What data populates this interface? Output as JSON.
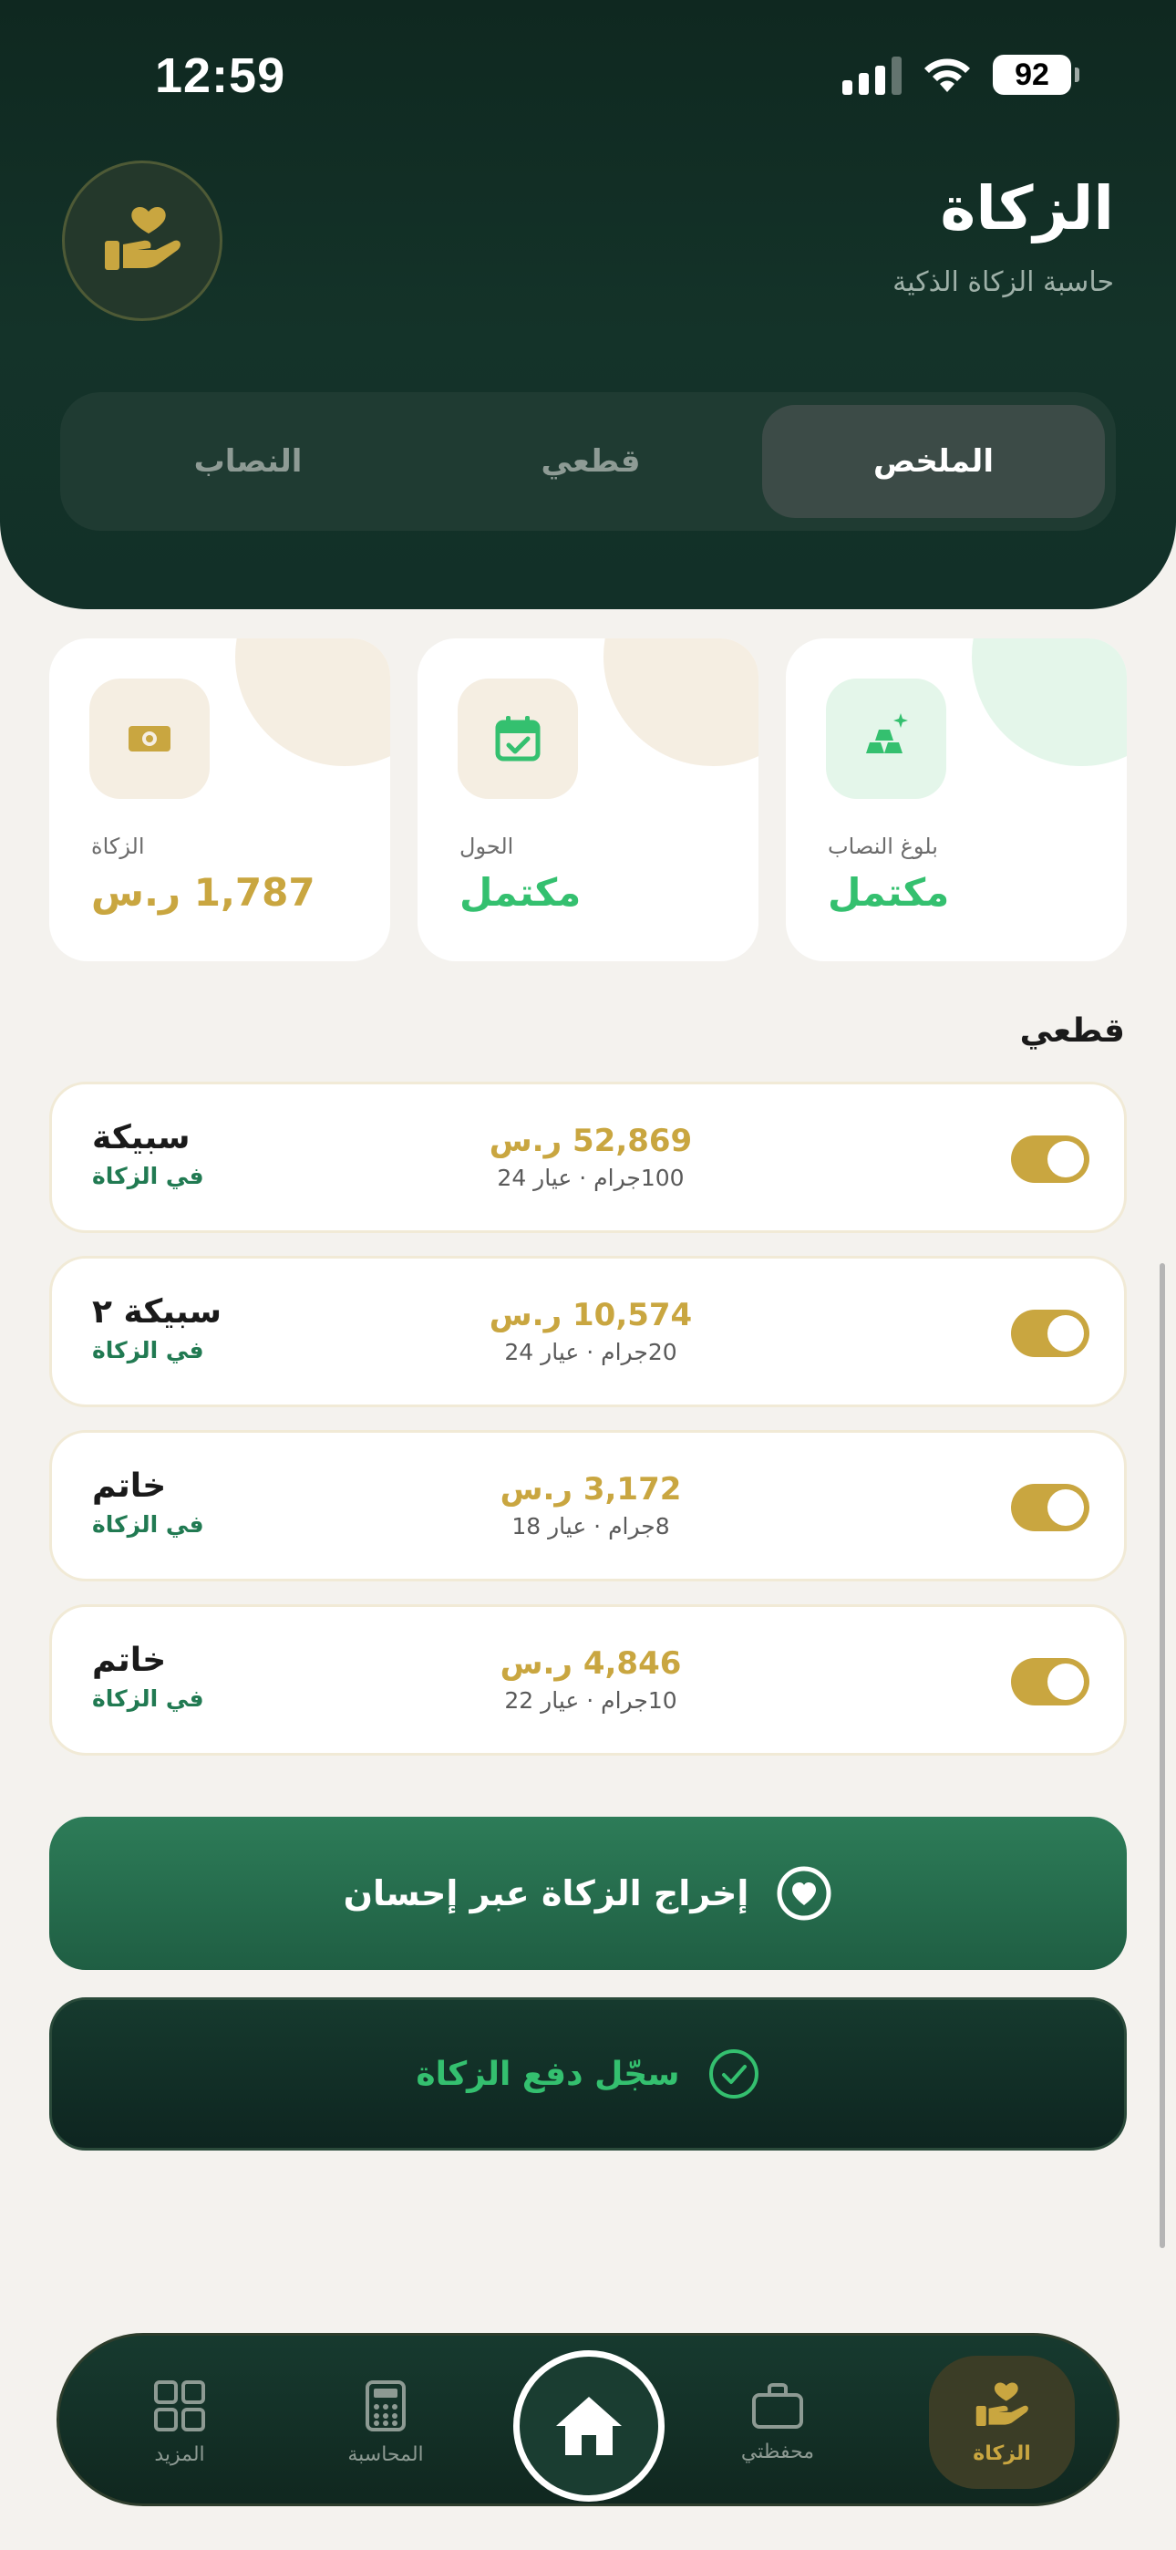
{
  "status_bar": {
    "time": "12:59",
    "battery": "92"
  },
  "header": {
    "title": "الزكاة",
    "subtitle": "حاسبة الزكاة الذكية",
    "tabs": [
      {
        "label": "الملخص",
        "active": true
      },
      {
        "label": "قطعي",
        "active": false
      },
      {
        "label": "النصاب",
        "active": false
      }
    ]
  },
  "summary": [
    {
      "label": "بلوغ النصاب",
      "value": "مكتمل",
      "icon": "gold-bars-icon",
      "color": "#34c06f"
    },
    {
      "label": "الحول",
      "value": "مكتمل",
      "icon": "calendar-check-icon",
      "color": "#34c06f"
    },
    {
      "label": "الزكاة",
      "value": "1,787 ر.س",
      "icon": "banknote-icon",
      "color": "#c9a640"
    }
  ],
  "section": {
    "title": "قطعي",
    "items": [
      {
        "name": "سبيكة",
        "tag": "في الزكاة",
        "price": "52,869 ر.س",
        "detail": "100جرام · عيار 24",
        "enabled": true
      },
      {
        "name": "سبيكة ٢",
        "tag": "في الزكاة",
        "price": "10,574 ر.س",
        "detail": "20جرام · عيار 24",
        "enabled": true
      },
      {
        "name": "خاتم",
        "tag": "في الزكاة",
        "price": "3,172 ر.س",
        "detail": "8جرام · عيار 18",
        "enabled": true
      },
      {
        "name": "خاتم",
        "tag": "في الزكاة",
        "price": "4,846 ر.س",
        "detail": "10جرام · عيار 22",
        "enabled": true
      }
    ]
  },
  "actions": {
    "primary_label": "إخراج الزكاة عبر إحسان",
    "secondary_label": "سجّل دفع الزكاة"
  },
  "tabbar": {
    "items": [
      {
        "label": "المزيد",
        "icon": "grid-icon"
      },
      {
        "label": "المحاسبة",
        "icon": "calculator-icon"
      },
      {
        "label": "",
        "icon": "home-icon"
      },
      {
        "label": "محفظتي",
        "icon": "briefcase-icon"
      },
      {
        "label": "الزكاة",
        "icon": "zakat-hand-heart-icon",
        "active": true
      }
    ]
  },
  "colors": {
    "gold": "#c9a640",
    "green": "#34c06f",
    "dark_green": "#123028"
  }
}
